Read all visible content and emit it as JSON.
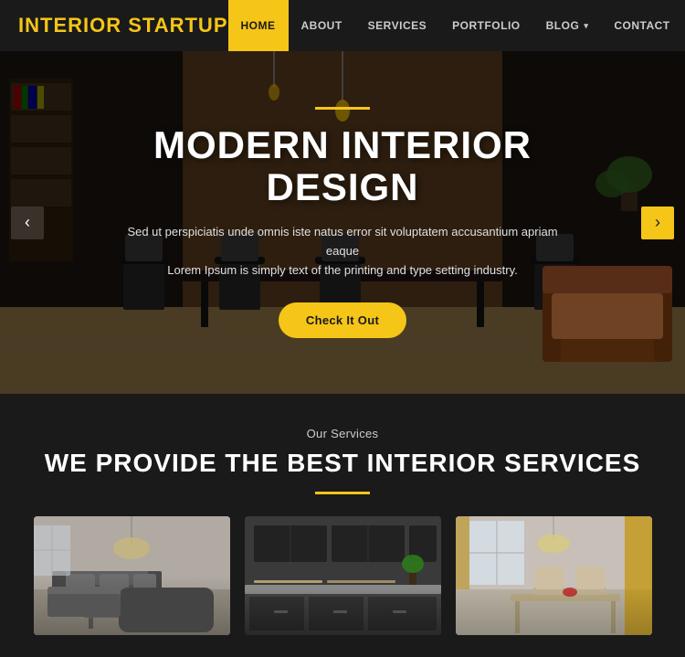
{
  "brand": {
    "name_part1": "INTERIOR ",
    "name_part2": "STARTUP"
  },
  "nav": {
    "links": [
      {
        "label": "HOME",
        "active": true
      },
      {
        "label": "ABOUT",
        "active": false
      },
      {
        "label": "SERVICES",
        "active": false
      },
      {
        "label": "PORTFOLIO",
        "active": false
      },
      {
        "label": "BLOG",
        "active": false,
        "dropdown": true
      },
      {
        "label": "CONTACT",
        "active": false
      }
    ]
  },
  "hero": {
    "line_decoration": "",
    "title": "MODERN INTERIOR DESIGN",
    "subtitle_line1": "Sed ut perspiciatis unde omnis iste natus error sit voluptatem accusantium apriam eaque",
    "subtitle_line2": "Lorem Ipsum is simply text of the printing and type setting industry.",
    "button_label": "Check it out",
    "prev_arrow": "‹",
    "next_arrow": "›"
  },
  "services": {
    "section_label": "Our Services",
    "section_title": "WE PROVIDE THE BEST INTERIOR SERVICES",
    "cards": [
      {
        "id": 1,
        "alt": "Living Room Interior"
      },
      {
        "id": 2,
        "alt": "Kitchen Interior"
      },
      {
        "id": 3,
        "alt": "Dining Room Interior"
      }
    ]
  }
}
